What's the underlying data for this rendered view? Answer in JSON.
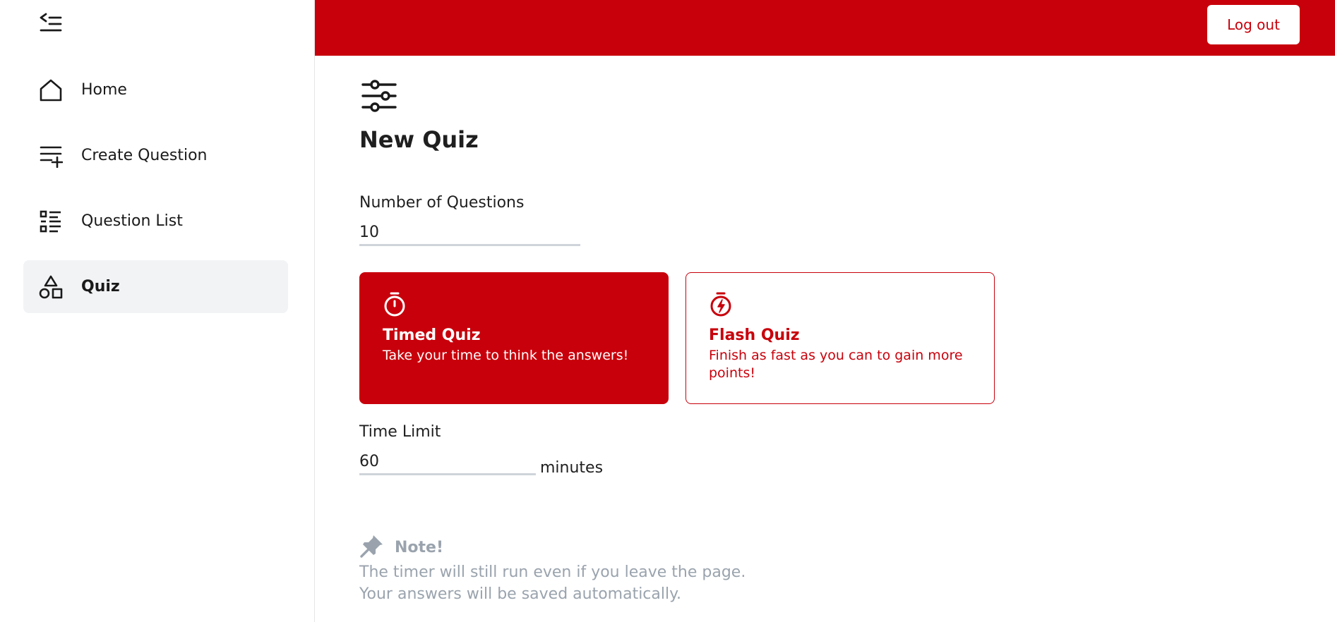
{
  "sidebar": {
    "items": [
      {
        "label": "Home",
        "icon": "home-icon",
        "active": false
      },
      {
        "label": "Create Question",
        "icon": "playlist-add-icon",
        "active": false
      },
      {
        "label": "Question List",
        "icon": "list-checks-icon",
        "active": false
      },
      {
        "label": "Quiz",
        "icon": "shapes-icon",
        "active": true
      }
    ]
  },
  "topbar": {
    "logout_label": "Log out",
    "color": "#c8000b"
  },
  "main": {
    "title": "New Quiz",
    "num_questions": {
      "label": "Number of Questions",
      "value": "10"
    },
    "modes": [
      {
        "title": "Timed Quiz",
        "description": "Take your time to think the answers!",
        "icon": "stopwatch-icon",
        "selected": true
      },
      {
        "title": "Flash Quiz",
        "description": "Finish as fast as you can to gain more points!",
        "icon": "stopwatch-bolt-icon",
        "selected": false
      }
    ],
    "time_limit": {
      "label": "Time Limit",
      "value": "60",
      "units": "minutes"
    },
    "note": {
      "title": "Note!",
      "icon": "pin-icon",
      "lines": [
        "The timer will still run even if you leave the page.",
        "Your answers will be saved automatically."
      ]
    }
  },
  "colors": {
    "accent": "#c8000b",
    "muted": "#9aa3ad",
    "active_bg": "#f2f3f5"
  }
}
